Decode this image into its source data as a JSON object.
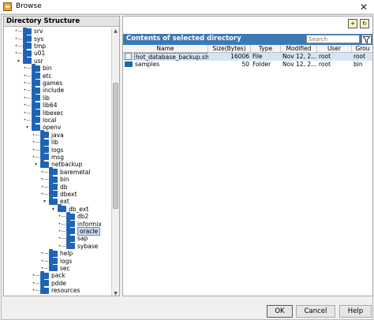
{
  "window": {
    "title": "Browse",
    "close_glyph": "✕",
    "icon": "folder-app-icon"
  },
  "tree": {
    "header": "Directory Structure",
    "items": [
      {
        "label": "srv",
        "depth": 1
      },
      {
        "label": "sys",
        "depth": 1
      },
      {
        "label": "tmp",
        "depth": 1
      },
      {
        "label": "u01",
        "depth": 1
      },
      {
        "label": "usr",
        "depth": 1,
        "expanded": true
      },
      {
        "label": "bin",
        "depth": 2
      },
      {
        "label": "etc",
        "depth": 2
      },
      {
        "label": "games",
        "depth": 2
      },
      {
        "label": "include",
        "depth": 2
      },
      {
        "label": "lib",
        "depth": 2
      },
      {
        "label": "lib64",
        "depth": 2
      },
      {
        "label": "libexec",
        "depth": 2
      },
      {
        "label": "local",
        "depth": 2
      },
      {
        "label": "openv",
        "depth": 2,
        "expanded": true
      },
      {
        "label": "java",
        "depth": 3
      },
      {
        "label": "lib",
        "depth": 3
      },
      {
        "label": "logs",
        "depth": 3
      },
      {
        "label": "msg",
        "depth": 3
      },
      {
        "label": "netbackup",
        "depth": 3,
        "expanded": true
      },
      {
        "label": "baremetal",
        "depth": 4
      },
      {
        "label": "bin",
        "depth": 4
      },
      {
        "label": "db",
        "depth": 4
      },
      {
        "label": "dbext",
        "depth": 4
      },
      {
        "label": "ext",
        "depth": 4,
        "expanded": true
      },
      {
        "label": "db_ext",
        "depth": 5,
        "expanded": true
      },
      {
        "label": "db2",
        "depth": 6
      },
      {
        "label": "informix",
        "depth": 6
      },
      {
        "label": "oracle",
        "depth": 6,
        "selected": true
      },
      {
        "label": "sap",
        "depth": 6
      },
      {
        "label": "sybase",
        "depth": 6
      },
      {
        "label": "help",
        "depth": 4
      },
      {
        "label": "logs",
        "depth": 4
      },
      {
        "label": "sec",
        "depth": 4
      },
      {
        "label": "pack",
        "depth": 3
      },
      {
        "label": "pdde",
        "depth": 3
      },
      {
        "label": "resources",
        "depth": 3
      }
    ]
  },
  "contents": {
    "title": "Contents of selected directory",
    "search_placeholder": "Search",
    "filter_icon": "filter-funnel-icon",
    "toolbar_icons": [
      "new-folder-icon",
      "refresh-icon"
    ],
    "columns": [
      "Name",
      "Size(Bytes)",
      "Type",
      "Modified",
      "User",
      "Grou"
    ],
    "rows": [
      {
        "name": "hot_database_backup.sh",
        "size": "16006",
        "type": "File",
        "modified": "Nov 12, 2...",
        "user": "root",
        "group": "root",
        "kind": "file",
        "selected": true
      },
      {
        "name": "samples",
        "size": "50",
        "type": "Folder",
        "modified": "Nov 12, 2...",
        "user": "root",
        "group": "bin",
        "kind": "folder",
        "selected": false
      }
    ]
  },
  "buttons": {
    "ok": "OK",
    "cancel": "Cancel",
    "help": "Help"
  },
  "colors": {
    "header_blue": "#3c78b4",
    "folder_blue": "#1f64b4",
    "selection": "#d6e4f5"
  }
}
